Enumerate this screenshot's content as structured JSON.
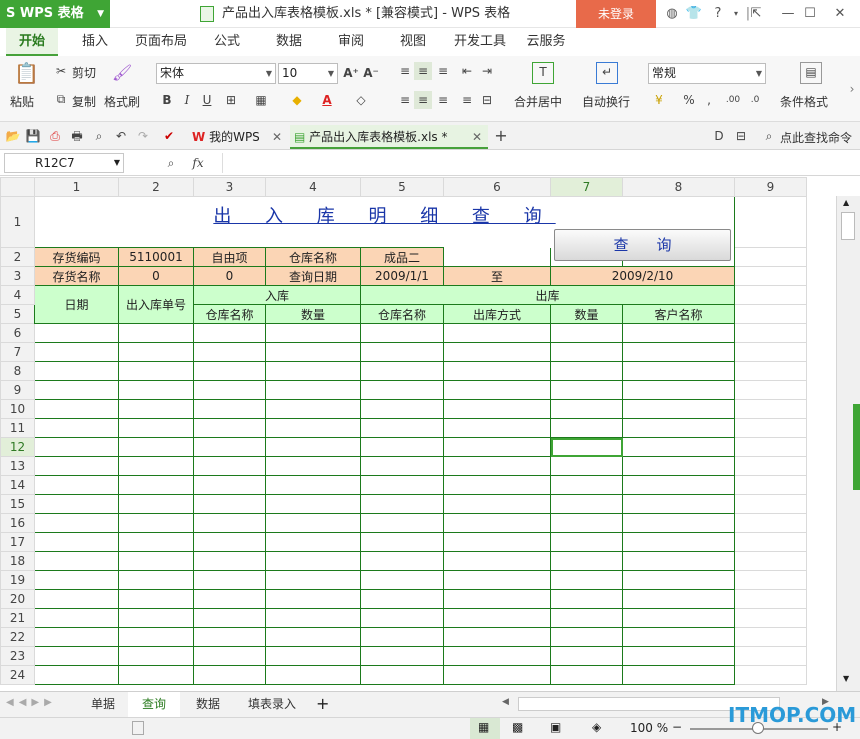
{
  "app": {
    "name": "WPS 表格",
    "doc_title": "产品出入库表格模板.xls * [兼容模式] - WPS 表格",
    "login": "未登录"
  },
  "menu_tabs": [
    "开始",
    "插入",
    "页面布局",
    "公式",
    "数据",
    "审阅",
    "视图",
    "开发工具",
    "云服务"
  ],
  "ribbon": {
    "paste": "粘贴",
    "cut": "剪切",
    "copy": "复制",
    "format_painter": "格式刷",
    "font_name": "宋体",
    "font_size": "10",
    "merge_center": "合并居中",
    "wrap_text": "自动换行",
    "number_format": "常规",
    "conditional_format": "条件格式"
  },
  "doc_tabs": [
    {
      "label": "我的WPS"
    },
    {
      "label": "产品出入库表格模板.xls *"
    }
  ],
  "find_command": "点此查找命令",
  "namebox": "R12C7",
  "fx": "fx",
  "columns": [
    "1",
    "2",
    "3",
    "4",
    "5",
    "6",
    "7",
    "8",
    "9"
  ],
  "rows": [
    "1",
    "2",
    "3",
    "4",
    "5",
    "6",
    "7",
    "8",
    "9",
    "10",
    "11",
    "12",
    "13",
    "14",
    "15",
    "16",
    "17",
    "18",
    "19",
    "20",
    "21",
    "22",
    "23",
    "24"
  ],
  "selected": {
    "row": "12",
    "col": "7"
  },
  "sheet": {
    "title": "出 入 库 明 细 查 询",
    "query_button": "查询",
    "r2": [
      "存货编码",
      "5110001",
      "自由项",
      "仓库名称",
      "成品二"
    ],
    "r3": [
      "存货名称",
      "0",
      "0",
      "查询日期",
      "2009/1/1",
      "至",
      "2009/2/10"
    ],
    "hdr_date": "日期",
    "hdr_docno": "出入库单号",
    "hdr_in": "入库",
    "hdr_out": "出库",
    "sub": [
      "仓库名称",
      "数量",
      "仓库名称",
      "出库方式",
      "数量",
      "客户名称"
    ]
  },
  "sheet_tabs": [
    "单据",
    "查询",
    "数据",
    "填表录入"
  ],
  "active_sheet_tab": "查询",
  "zoom": "100 %",
  "watermark": "ITMOP.COM"
}
